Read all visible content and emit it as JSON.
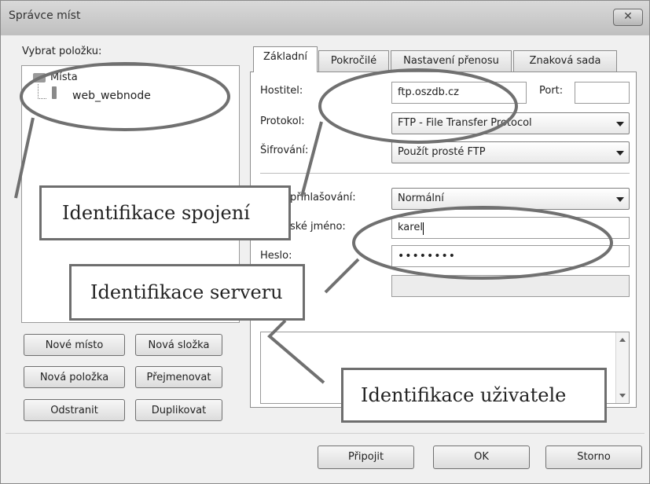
{
  "window": {
    "title": "Správce míst",
    "close_glyph": "✕"
  },
  "left": {
    "select_label": "Vybrat položku:",
    "tree": {
      "root": "Místa",
      "child": "web_webnode"
    },
    "buttons": {
      "new_site": "Nové místo",
      "new_folder": "Nová složka",
      "new_bookmark": "Nová položka",
      "rename": "Přejmenovat",
      "delete": "Odstranit",
      "duplicate": "Duplikovat"
    }
  },
  "tabs": [
    "Základní",
    "Pokročilé",
    "Nastavení přenosu",
    "Znaková sada"
  ],
  "form": {
    "host_label": "Hostitel:",
    "host_value": "ftp.oszdb.cz",
    "port_label": "Port:",
    "port_value": "",
    "protocol_label": "Protokol:",
    "protocol_value": "FTP - File Transfer Protocol",
    "encryption_label": "Šifrování:",
    "encryption_value": "Použít prosté FTP",
    "logon_label": "přihlašování:",
    "logon_value": "Normální",
    "user_label": "ské jméno:",
    "user_value": "karel",
    "password_label": "Heslo:",
    "password_value": "••••••••",
    "account_value": ""
  },
  "bottom_buttons": {
    "connect": "Připojit",
    "ok": "OK",
    "cancel": "Storno"
  },
  "callouts": {
    "connection": "Identifikace spojení",
    "server": "Identifikace serveru",
    "user": "Identifikace uživatele"
  },
  "colors": {
    "window_bg": "#f0f0f0",
    "callout_border": "#6e6e6e",
    "annotation_line": "#707070"
  }
}
